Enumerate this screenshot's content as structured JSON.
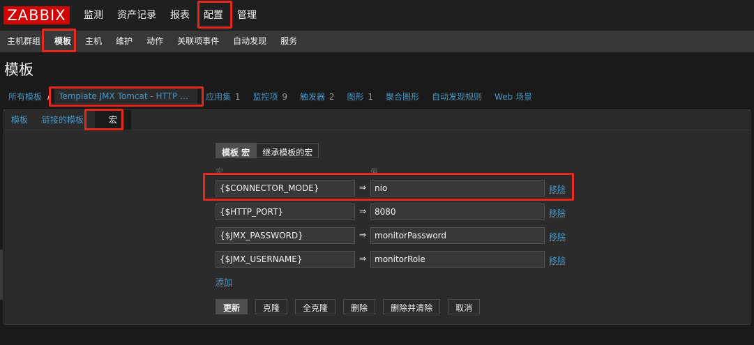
{
  "logo": "ZABBIX",
  "main_menu": [
    "监测",
    "资产记录",
    "报表",
    "配置",
    "管理"
  ],
  "sub_menu": [
    "主机群组",
    "模板",
    "主机",
    "维护",
    "动作",
    "关联项事件",
    "自动发现",
    "服务"
  ],
  "page_title": "模板",
  "breadcrumb": {
    "all": "所有模板",
    "sep": "/",
    "current": "Template JMX Tomcat - HTTP Con…",
    "apps": "应用集",
    "apps_count": "1",
    "items": "监控项",
    "items_count": "9",
    "triggers": "触发器",
    "triggers_count": "2",
    "graphs": "图形",
    "graphs_count": "1",
    "screens": "聚合图形",
    "discovery": "自动发现规则",
    "web": "Web 场景"
  },
  "tabs": [
    "模板",
    "链接的模板",
    "宏"
  ],
  "macro_tabs": [
    "模板 宏",
    "继承模板的宏"
  ],
  "columns": {
    "macro": "宏",
    "value": "值"
  },
  "macros": [
    {
      "name": "{$CONNECTOR_MODE}",
      "value": "nio"
    },
    {
      "name": "{$HTTP_PORT}",
      "value": "8080"
    },
    {
      "name": "{$JMX_PASSWORD}",
      "value": "monitorPassword"
    },
    {
      "name": "{$JMX_USERNAME}",
      "value": "monitorRole"
    }
  ],
  "arrow": "⇒",
  "remove_label": "移除",
  "add_label": "添加",
  "buttons": [
    "更新",
    "克隆",
    "全克隆",
    "删除",
    "删除并清除",
    "取消"
  ],
  "colors": {
    "highlight": "#e8281a",
    "link": "#4796c4",
    "logo": "#d40000"
  }
}
